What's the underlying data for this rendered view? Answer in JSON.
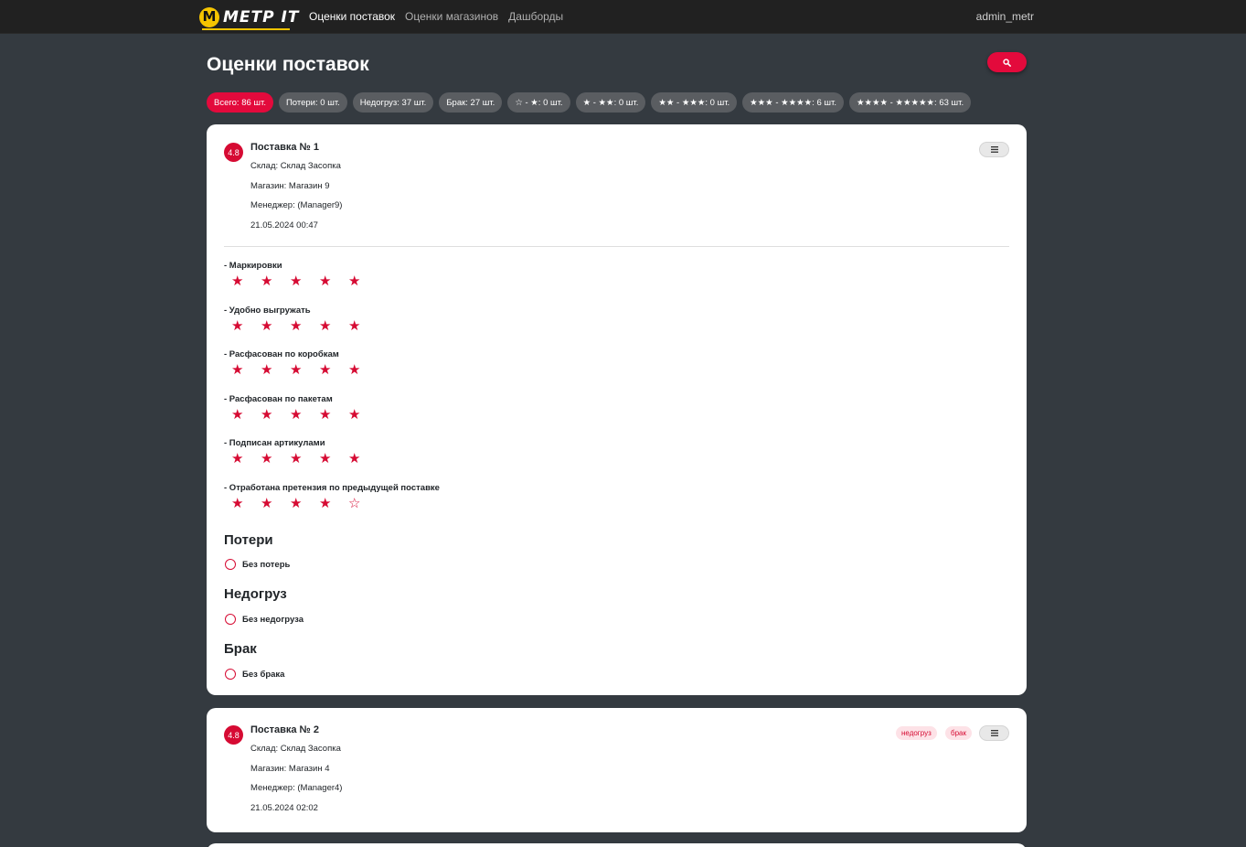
{
  "nav": {
    "logo_letter": "M",
    "logo_text": "МЕТР IT",
    "links": [
      "Оценки поставок",
      "Оценки магазинов",
      "Дашборды"
    ],
    "user": "admin_metr"
  },
  "page": {
    "title": "Оценки поставок"
  },
  "search": {
    "icon": "search-icon"
  },
  "filters": [
    "Всего: 86 шт.",
    "Потери: 0 шт.",
    "Недогруз: 37 шт.",
    "Брак: 27 шт.",
    "☆ - ★: 0 шт.",
    "★ - ★★: 0 шт.",
    "★★ - ★★★: 0 шт.",
    "★★★ - ★★★★: 6 шт.",
    "★★★★ - ★★★★★: 63 шт."
  ],
  "colors": {
    "accent": "#e30a3c",
    "background": "#343a40",
    "navbar": "#212121",
    "logo": "#f5c400"
  },
  "deliveries": [
    {
      "score": "4.8",
      "title": "Поставка № 1",
      "warehouse": "Склад: Склад Засопка",
      "store": "Магазин: Магазин 9",
      "manager": "Менеджер: (Manager9)",
      "date": "21.05.2024 00:47",
      "tags": [],
      "criteria": [
        {
          "label": "- Маркировки",
          "rating": 5,
          "max": 5
        },
        {
          "label": "- Удобно выгружать",
          "rating": 5,
          "max": 5
        },
        {
          "label": "- Расфасован по коробкам",
          "rating": 5,
          "max": 5
        },
        {
          "label": "- Расфасован по пакетам",
          "rating": 5,
          "max": 5
        },
        {
          "label": "- Подписан артикулами",
          "rating": 5,
          "max": 5
        },
        {
          "label": "- Отработана претензия по предыдущей поставке",
          "rating": 4,
          "max": 5
        }
      ],
      "sections": [
        {
          "title": "Потери",
          "option": "Без потерь"
        },
        {
          "title": "Недогруз",
          "option": "Без недогруза"
        },
        {
          "title": "Брак",
          "option": "Без брака"
        }
      ]
    },
    {
      "score": "4.8",
      "title": "Поставка № 2",
      "warehouse": "Склад: Склад Засопка",
      "store": "Магазин: Магазин 4",
      "manager": "Менеджер: (Manager4)",
      "date": "21.05.2024 02:02",
      "tags": [
        "недогруз",
        "брак"
      ]
    }
  ]
}
